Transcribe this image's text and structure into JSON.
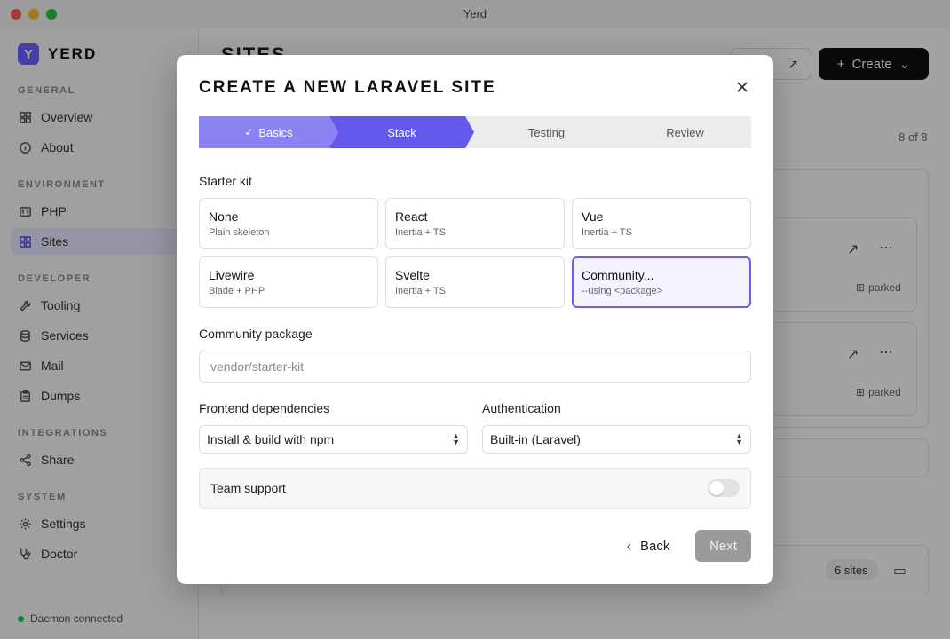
{
  "window": {
    "title": "Yerd"
  },
  "sidebar": {
    "brand": {
      "logo": "Y",
      "name": "YERD"
    },
    "sections": {
      "general": "GENERAL",
      "environment": "ENVIRONMENT",
      "developer": "DEVELOPER",
      "integrations": "INTEGRATIONS",
      "system": "SYSTEM"
    },
    "items": {
      "overview": "Overview",
      "about": "About",
      "php": "PHP",
      "sites": "Sites",
      "tooling": "Tooling",
      "services": "Services",
      "mail": "Mail",
      "dumps": "Dumps",
      "share": "Share",
      "settings": "Settings",
      "doctor": "Doctor"
    },
    "status": "Daemon connected"
  },
  "main": {
    "title": "SITES",
    "create_label": "Create",
    "count": "8 of 8",
    "parked_label": "parked",
    "group_badge": "6 sites"
  },
  "modal": {
    "title": "CREATE A NEW LARAVEL SITE",
    "steps": [
      "Basics",
      "Stack",
      "Testing",
      "Review"
    ],
    "starter_kit_label": "Starter kit",
    "kits": [
      {
        "name": "None",
        "sub": "Plain skeleton"
      },
      {
        "name": "React",
        "sub": "Inertia + TS"
      },
      {
        "name": "Vue",
        "sub": "Inertia + TS"
      },
      {
        "name": "Livewire",
        "sub": "Blade + PHP"
      },
      {
        "name": "Svelte",
        "sub": "Inertia + TS"
      },
      {
        "name": "Community...",
        "sub": "--using <package>"
      }
    ],
    "community_label": "Community package",
    "community_placeholder": "vendor/starter-kit",
    "frontend_label": "Frontend dependencies",
    "frontend_value": "Install & build with npm",
    "auth_label": "Authentication",
    "auth_value": "Built-in (Laravel)",
    "team_label": "Team support",
    "team_enabled": false,
    "back_label": "Back",
    "next_label": "Next"
  },
  "colors": {
    "accent": "#6258ec",
    "accent_light": "#8b83f3",
    "status_ok": "#22c55e"
  }
}
